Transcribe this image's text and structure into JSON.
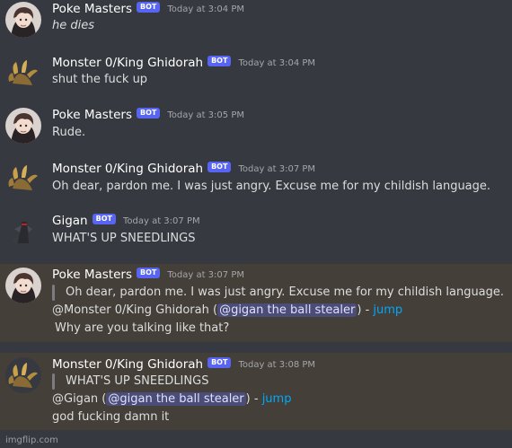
{
  "messages": [
    {
      "author": "Poke Masters",
      "bot_tag": "BOT",
      "time": "Today at 3:04 PM",
      "text": "he dies"
    },
    {
      "author": "Monster 0/King Ghidorah",
      "bot_tag": "BOT",
      "time": "Today at 3:04 PM",
      "text": "shut the fuck up"
    },
    {
      "author": "Poke Masters",
      "bot_tag": "BOT",
      "time": "Today at 3:05 PM",
      "text": "Rude."
    },
    {
      "author": "Monster 0/King Ghidorah",
      "bot_tag": "BOT",
      "time": "Today at 3:07 PM",
      "text": "Oh dear, pardon me. I was just angry. Excuse me for my childish language."
    },
    {
      "author": "Gigan",
      "bot_tag": "BOT",
      "time": "Today at 3:07 PM",
      "text": "WHAT'S UP SNEEDLINGS"
    },
    {
      "author": "Poke Masters",
      "bot_tag": "BOT",
      "time": "Today at 3:07 PM",
      "quote": "Oh dear, pardon me. I was just angry. Excuse me for my childish language.",
      "reply_prefix": "@Monster 0/King Ghidorah (",
      "reply_mention": "@gigan the ball stealer",
      "reply_suffix": ") - ",
      "reply_link": "jump",
      "text": "Why are you talking like that?"
    },
    {
      "author": "Monster 0/King Ghidorah",
      "bot_tag": "BOT",
      "time": "Today at 3:08 PM",
      "quote": "WHAT'S UP SNEEDLINGS",
      "reply_prefix": "@Gigan (",
      "reply_mention": "@gigan the ball stealer",
      "reply_suffix": ") - ",
      "reply_link": "jump",
      "text": "god fucking damn it"
    }
  ],
  "watermark": "imgflip.com",
  "colors": {
    "background": "#36393f",
    "highlight": "#443f38",
    "bot_badge": "#5865f2",
    "link": "#00a8fc"
  }
}
